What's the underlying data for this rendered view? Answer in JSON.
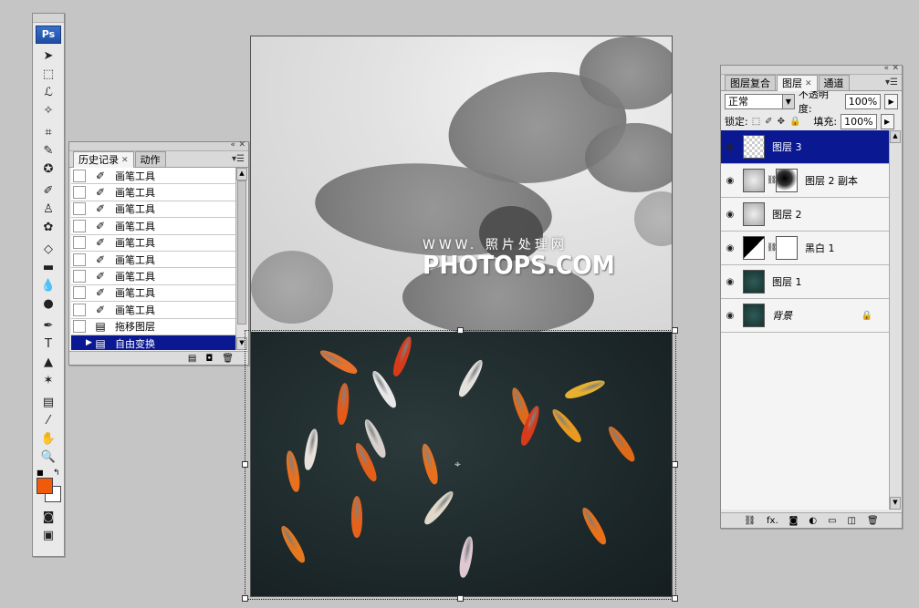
{
  "tools_panel": {
    "logo": "Ps",
    "tools": [
      {
        "name": "move-tool-icon",
        "glyph": "➤"
      },
      {
        "name": "marquee-tool-icon",
        "glyph": "⬚"
      },
      {
        "name": "lasso-tool-icon",
        "glyph": "ℒ"
      },
      {
        "name": "magic-wand-tool-icon",
        "glyph": "✧"
      },
      {
        "name": "crop-tool-icon",
        "glyph": "⌗"
      },
      {
        "name": "eyedropper-slice-tool-icon",
        "glyph": "✎"
      },
      {
        "name": "healing-brush-tool-icon",
        "glyph": "✪"
      },
      {
        "name": "brush-tool-icon",
        "glyph": "✐"
      },
      {
        "name": "clone-stamp-tool-icon",
        "glyph": "♙"
      },
      {
        "name": "history-brush-tool-icon",
        "glyph": "✿"
      },
      {
        "name": "eraser-tool-icon",
        "glyph": "◇"
      },
      {
        "name": "gradient-tool-icon",
        "glyph": "▬"
      },
      {
        "name": "blur-tool-icon",
        "glyph": "💧"
      },
      {
        "name": "dodge-tool-icon",
        "glyph": "●"
      },
      {
        "name": "pen-tool-icon",
        "glyph": "✒"
      },
      {
        "name": "type-tool-icon",
        "glyph": "T"
      },
      {
        "name": "path-selection-tool-icon",
        "glyph": "▲"
      },
      {
        "name": "custom-shape-tool-icon",
        "glyph": "✶"
      },
      {
        "name": "notes-tool-icon",
        "glyph": "▤"
      },
      {
        "name": "eyedropper-tool-icon",
        "glyph": "⁄"
      },
      {
        "name": "hand-tool-icon",
        "glyph": "✋"
      },
      {
        "name": "zoom-tool-icon",
        "glyph": "🔍"
      }
    ],
    "foreground_color": "#f15a0b",
    "background_color": "#ffffff"
  },
  "history_panel": {
    "tabs": [
      {
        "label": "历史记录",
        "active": true
      },
      {
        "label": "动作",
        "active": false
      }
    ],
    "rows": [
      {
        "label": "画笔工具",
        "icon": "brush"
      },
      {
        "label": "画笔工具",
        "icon": "brush"
      },
      {
        "label": "画笔工具",
        "icon": "brush"
      },
      {
        "label": "画笔工具",
        "icon": "brush"
      },
      {
        "label": "画笔工具",
        "icon": "brush"
      },
      {
        "label": "画笔工具",
        "icon": "brush"
      },
      {
        "label": "画笔工具",
        "icon": "brush"
      },
      {
        "label": "画笔工具",
        "icon": "brush"
      },
      {
        "label": "画笔工具",
        "icon": "brush"
      },
      {
        "label": "拖移图层",
        "icon": "doc"
      },
      {
        "label": "自由变换",
        "icon": "doc",
        "selected": true
      }
    ]
  },
  "canvas": {
    "watermark_small": "WWW. 照片处理网",
    "watermark_big": "PHOTOPS.COM"
  },
  "layers_panel": {
    "tabs": [
      {
        "label": "图层复合",
        "active": false
      },
      {
        "label": "图层",
        "active": true
      },
      {
        "label": "通道",
        "active": false
      }
    ],
    "blend_mode": "正常",
    "opacity_label": "不透明度:",
    "opacity_value": "100%",
    "lock_label": "锁定:",
    "fill_label": "填充:",
    "fill_value": "100%",
    "layers": [
      {
        "name": "图层 3",
        "selected": true,
        "thumb": "transparent",
        "has_mask": false
      },
      {
        "name": "图层 2 副本",
        "selected": false,
        "thumb": "gray",
        "has_mask": true,
        "mask": "ink"
      },
      {
        "name": "图层 2",
        "selected": false,
        "thumb": "gray",
        "has_mask": false
      },
      {
        "name": "黑白 1",
        "selected": false,
        "thumb": "adjust",
        "has_mask": true,
        "mask": "white"
      },
      {
        "name": "图层 1",
        "selected": false,
        "thumb": "dark",
        "has_mask": false
      },
      {
        "name": "背景",
        "selected": false,
        "thumb": "dark",
        "has_mask": false,
        "locked": true,
        "italic": true
      }
    ]
  }
}
